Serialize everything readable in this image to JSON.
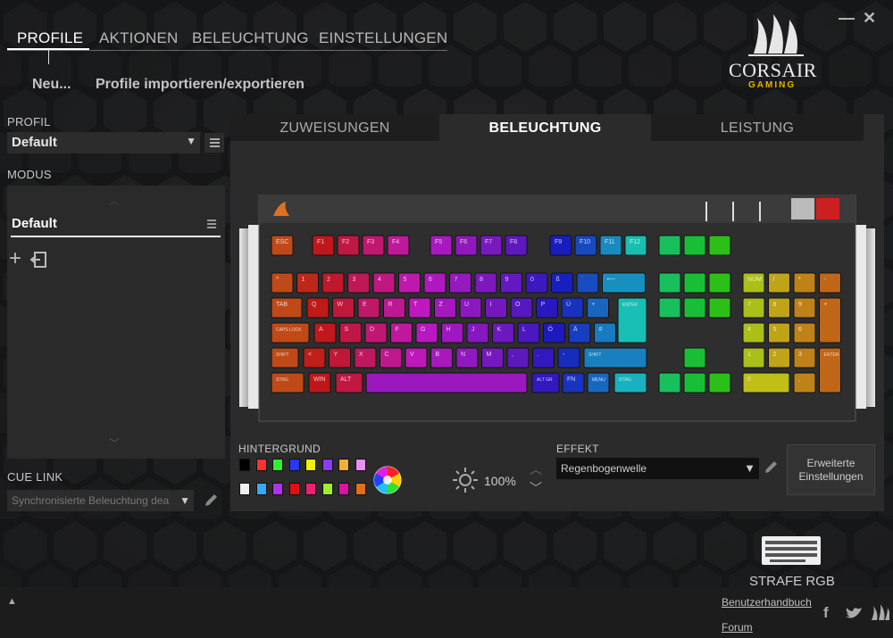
{
  "window": {
    "minimize": "—",
    "close": "✕"
  },
  "nav": {
    "tabs": [
      "PROFILE",
      "AKTIONEN",
      "BELEUCHTUNG",
      "EINSTELLUNGEN"
    ]
  },
  "subnav": {
    "new": "Neu...",
    "import_export": "Profile importieren/exportieren"
  },
  "brand": {
    "name": "CORSAIR",
    "sub": "GAMING"
  },
  "left": {
    "profile_label": "PROFIL",
    "profile_value": "Default",
    "mode_label": "MODUS",
    "mode_item": "Default",
    "cue_link_label": "CUE LINK",
    "cue_link_value": "Synchronisierte Beleuchtung dea"
  },
  "right": {
    "tabs": [
      "ZUWEISUNGEN",
      "BELEUCHTUNG",
      "LEISTUNG"
    ],
    "background_label": "HINTERGRUND",
    "brightness": "100%",
    "effect_label": "EFFEKT",
    "effect_value": "Regenbogenwelle",
    "advanced_button": "Erweiterte Einstellungen"
  },
  "swatches_row1": [
    "#000000",
    "#ff3030",
    "#33ee33",
    "#2a35ff",
    "#f0f000",
    "#8a3bff",
    "#f0b030",
    "#e890f0"
  ],
  "swatches_row2": [
    "#f0f0f0",
    "#3aa8f0",
    "#b030f0",
    "#e01010",
    "#f02070",
    "#a0f020",
    "#e010a0",
    "#e07010"
  ],
  "device": {
    "name": "STRAFE RGB"
  },
  "footer": {
    "manual": "Benutzerhandbuch",
    "forum": "Forum",
    "expand": "▲"
  },
  "keyboard": {
    "row_fn": [
      "ESC",
      "F1",
      "F2",
      "F3",
      "F4",
      "F5",
      "F6",
      "F7",
      "F8",
      "F9",
      "F10",
      "F11",
      "F12"
    ],
    "row1": [
      "^",
      "1",
      "2",
      "3",
      "4",
      "5",
      "6",
      "7",
      "8",
      "9",
      "0",
      "ß",
      "´",
      "⟵"
    ],
    "row2": [
      "TAB",
      "Q",
      "W",
      "E",
      "R",
      "T",
      "Z",
      "U",
      "I",
      "O",
      "P",
      "Ü",
      "+",
      "ENTER"
    ],
    "row3": [
      "CAPS LOCK",
      "A",
      "S",
      "D",
      "F",
      "G",
      "H",
      "J",
      "K",
      "L",
      "Ö",
      "Ä",
      "#"
    ],
    "row4": [
      "SHIFT",
      "<",
      "Y",
      "X",
      "C",
      "V",
      "B",
      "N",
      "M",
      ",",
      ".",
      "-",
      "SHIFT"
    ],
    "row5": [
      "STRG",
      "WIN",
      "ALT",
      "",
      "ALT GR",
      "FN",
      "MENU",
      "STRG"
    ],
    "numpad_top": [
      "NUM",
      "/",
      "*",
      "-"
    ],
    "numpad_r2": [
      "7",
      "8",
      "9",
      "+"
    ],
    "numpad_r3": [
      "4",
      "5",
      "6"
    ],
    "numpad_r4": [
      "1",
      "2",
      "3",
      "ENTER"
    ],
    "numpad_r5": [
      "0",
      ","
    ]
  }
}
